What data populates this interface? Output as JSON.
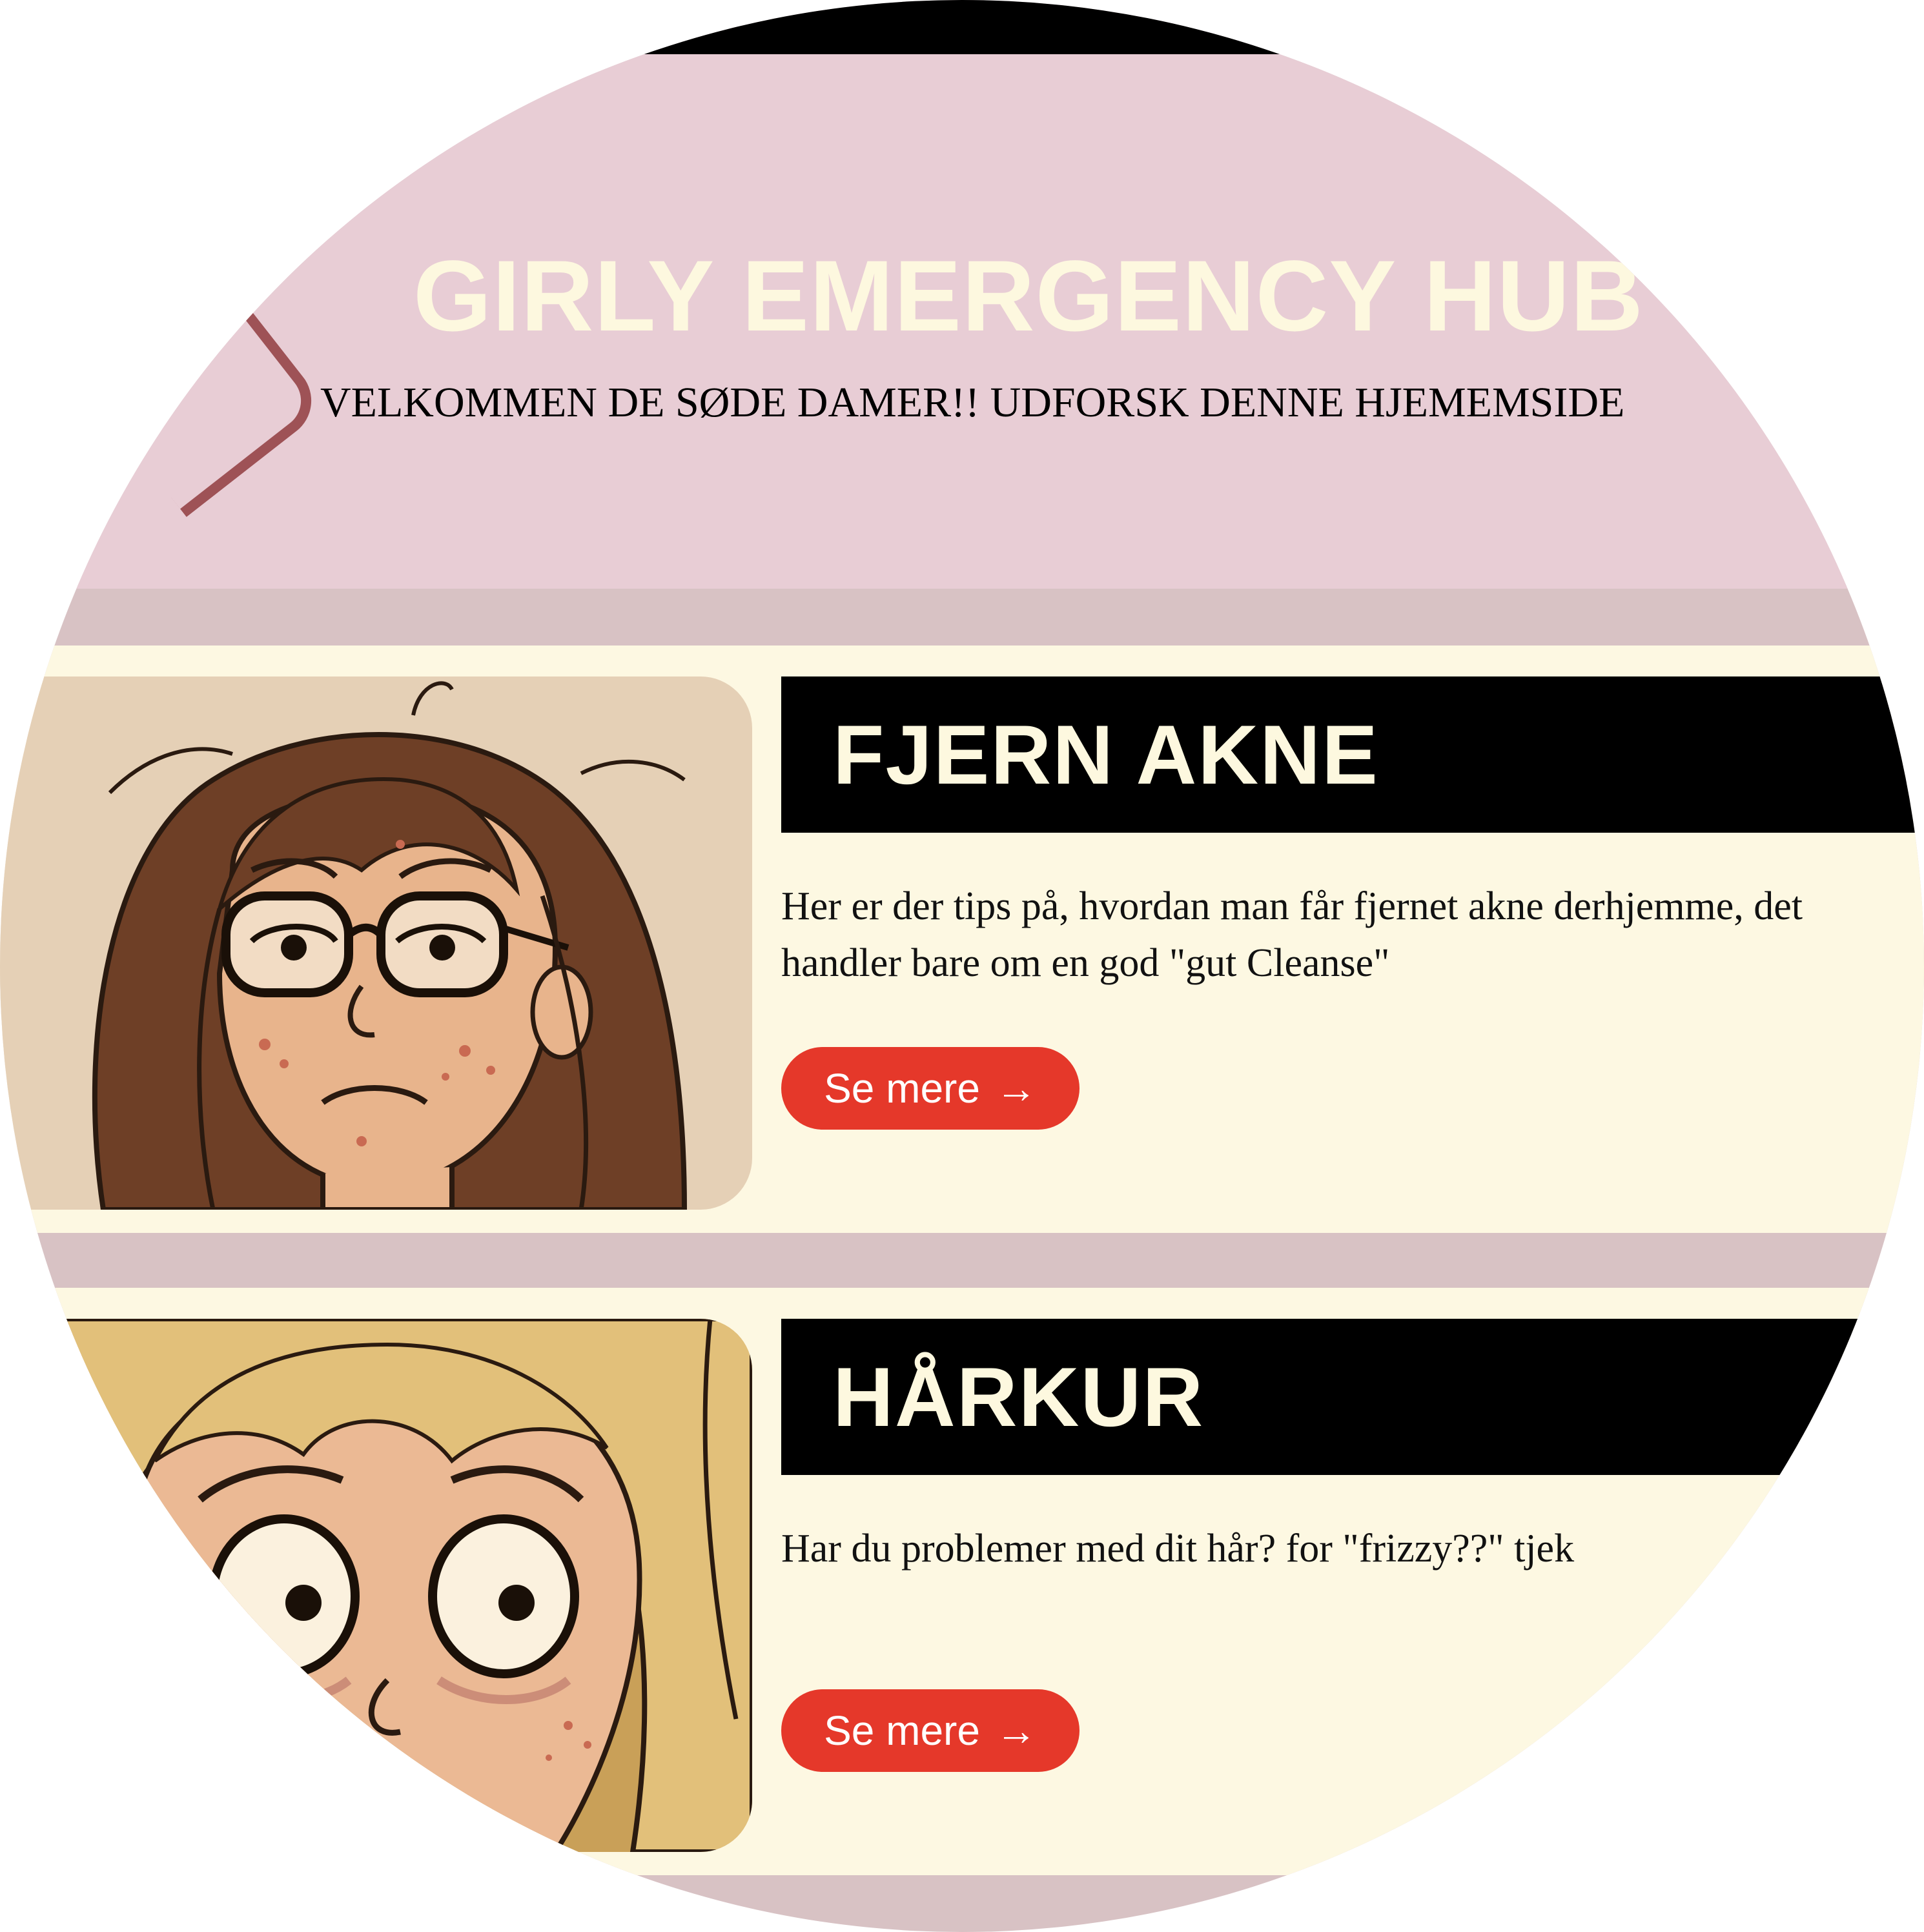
{
  "colors": {
    "page_bg": "#d8c2c4",
    "hero_bg": "#e8cdd5",
    "title_color": "#fdf8df",
    "card_bg": "#fdf8e2",
    "heading_bg": "#000000",
    "heading_text": "#fdf8df",
    "button_bg": "#e5382a",
    "button_text": "#ffffff"
  },
  "hero": {
    "title": "GIRLY EMERGENCY HUB",
    "subtitle": "VELKOMMEN DE SØDE DAMER!! UDFORSK DENNE HJEMEMSIDE"
  },
  "cards": [
    {
      "title": "FJERN AKNE",
      "description": "Her er der tips på, hvordan man får fjernet akne derhjemme, det handler bare om en god \"gut Cleanse\"",
      "button_label": "Se mere",
      "button_arrow": "→",
      "image_icon": "tired-girl-with-glasses-illustration"
    },
    {
      "title": "HÅRKUR",
      "description": "Har du problemer med dit hår? for \"frizzy??\" tjek",
      "button_label": "Se mere",
      "button_arrow": "→",
      "image_icon": "worried-blonde-girl-illustration"
    }
  ]
}
